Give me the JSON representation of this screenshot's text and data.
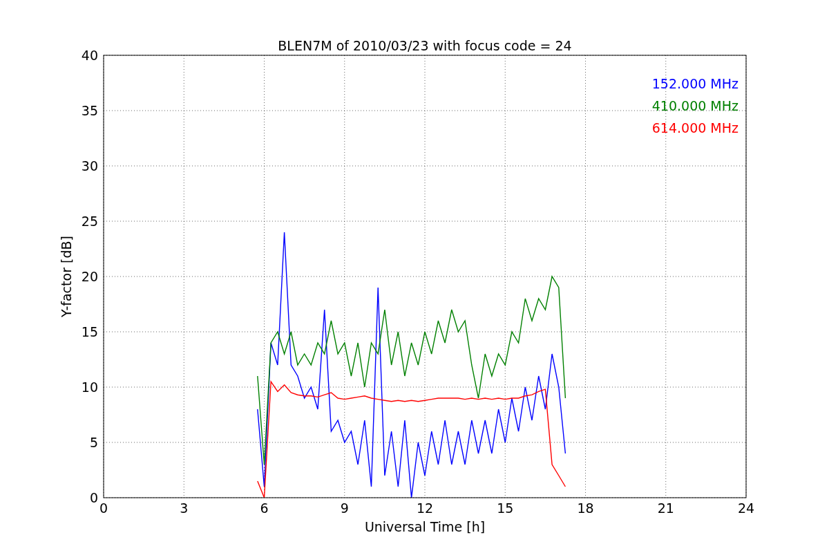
{
  "figure": {
    "chart_data": {
      "type": "line",
      "title": "BLEN7M of 2010/03/23 with focus code = 24",
      "xlabel": "Universal Time [h]",
      "ylabel": "Y-factor [dB]",
      "xlim": [
        0,
        24
      ],
      "ylim": [
        0,
        40
      ],
      "xticks": [
        0,
        3,
        6,
        9,
        12,
        15,
        18,
        21,
        24
      ],
      "yticks": [
        0,
        5,
        10,
        15,
        20,
        25,
        30,
        35,
        40
      ],
      "grid": true,
      "x": [
        5.75,
        6,
        6.25,
        6.5,
        6.75,
        7,
        7.25,
        7.5,
        7.75,
        8,
        8.25,
        8.5,
        8.75,
        9,
        9.25,
        9.5,
        9.75,
        10,
        10.25,
        10.5,
        10.75,
        11,
        11.25,
        11.5,
        11.75,
        12,
        12.25,
        12.5,
        12.75,
        13,
        13.25,
        13.5,
        13.75,
        14,
        14.25,
        14.5,
        14.75,
        15,
        15.25,
        15.5,
        15.75,
        16,
        16.25,
        16.5,
        16.75,
        17,
        17.25
      ],
      "series": [
        {
          "name": "152.000 MHz",
          "color": "#0000ff",
          "values": [
            8,
            1,
            14,
            12,
            24,
            12,
            11,
            9,
            10,
            8,
            17,
            6,
            7,
            5,
            6,
            3,
            7,
            1,
            19,
            2,
            6,
            1,
            7,
            0,
            5,
            2,
            6,
            3,
            7,
            3,
            6,
            3,
            7,
            4,
            7,
            4,
            8,
            5,
            9,
            6,
            10,
            7,
            11,
            8,
            13,
            10,
            4
          ]
        },
        {
          "name": "410.000 MHz",
          "color": "#008000",
          "values": [
            11,
            3,
            14,
            15,
            13,
            15,
            12,
            13,
            12,
            14,
            13,
            16,
            13,
            14,
            11,
            14,
            10,
            14,
            13,
            17,
            12,
            15,
            11,
            14,
            12,
            15,
            13,
            16,
            14,
            17,
            15,
            16,
            12,
            9,
            13,
            11,
            13,
            12,
            15,
            14,
            18,
            16,
            18,
            17,
            20,
            19,
            9
          ]
        },
        {
          "name": "614.000 MHz",
          "color": "#ff0000",
          "values": [
            1.5,
            0,
            10.5,
            9.6,
            10.2,
            9.5,
            9.3,
            9.2,
            9.2,
            9.1,
            9.3,
            9.5,
            9.0,
            8.9,
            9.0,
            9.1,
            9.2,
            9.0,
            8.9,
            8.8,
            8.7,
            8.8,
            8.7,
            8.8,
            8.7,
            8.8,
            8.9,
            9.0,
            9.0,
            9.0,
            9.0,
            8.9,
            9.0,
            8.9,
            9.0,
            8.9,
            9.0,
            8.9,
            9.0,
            9.0,
            9.2,
            9.3,
            9.6,
            9.8,
            3,
            2,
            1
          ]
        }
      ]
    }
  }
}
